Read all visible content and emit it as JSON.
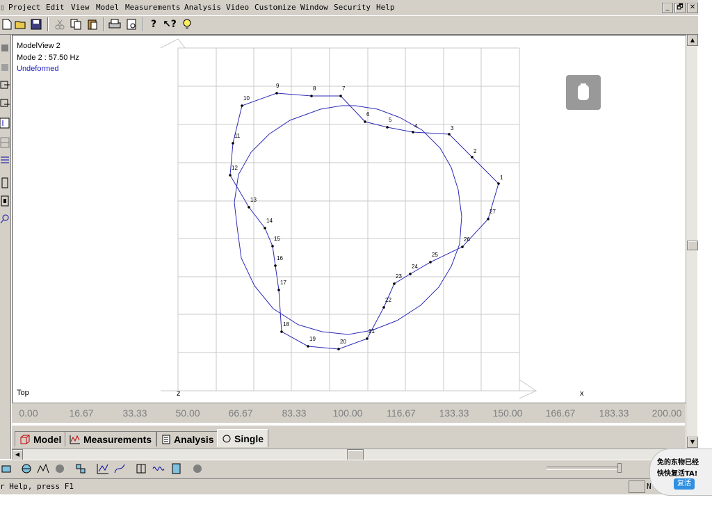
{
  "menu": [
    "Project",
    "Edit",
    "View",
    "Model",
    "Measurements",
    "Analysis",
    "Video",
    "Customize",
    "Window",
    "Security",
    "Help"
  ],
  "window_controls": [
    "_",
    "🗗",
    "✕"
  ],
  "modelview": {
    "title": "ModelView 2",
    "mode": "Mode 2 : 57.50 Hz",
    "state": "Undeformed",
    "view_label": "Top",
    "axis_z": "z",
    "axis_x": "x"
  },
  "freq_axis": [
    "0.00",
    "16.67",
    "33.33",
    "50.00",
    "66.67",
    "83.33",
    "100.00",
    "116.67",
    "133.33",
    "150.00",
    "166.67",
    "183.33",
    "200.00"
  ],
  "tabs": [
    {
      "label": "Model",
      "icon": "cube-icon",
      "active": false
    },
    {
      "label": "Measurements",
      "icon": "chart-icon",
      "active": false
    },
    {
      "label": "Analysis",
      "icon": "document-icon",
      "active": false
    },
    {
      "label": "Single",
      "icon": "circle-arrow-icon",
      "active": true
    }
  ],
  "status": {
    "help": "r Help, press F1",
    "indicator": "N"
  },
  "popup": {
    "line1": "免的东物已经",
    "line2": "快快复活TA!",
    "button": "复活"
  },
  "colors": {
    "mesh": "#2b2bb5",
    "state_text": "#2020c0",
    "chrome": "#d4d0c8"
  },
  "chart_data": {
    "type": "wireframe",
    "nodes": [
      {
        "id": "1"
      },
      {
        "id": "2"
      },
      {
        "id": "3"
      },
      {
        "id": "4"
      },
      {
        "id": "5"
      },
      {
        "id": "6"
      },
      {
        "id": "7"
      },
      {
        "id": "8"
      },
      {
        "id": "9"
      },
      {
        "id": "10"
      },
      {
        "id": "11"
      },
      {
        "id": "12"
      },
      {
        "id": "13"
      },
      {
        "id": "14"
      },
      {
        "id": "15"
      },
      {
        "id": "16"
      },
      {
        "id": "17"
      },
      {
        "id": "18"
      },
      {
        "id": "19"
      },
      {
        "id": "20"
      },
      {
        "id": "21"
      },
      {
        "id": "22"
      },
      {
        "id": "23"
      },
      {
        "id": "24"
      },
      {
        "id": "25"
      },
      {
        "id": "26"
      },
      {
        "id": "27"
      }
    ]
  }
}
